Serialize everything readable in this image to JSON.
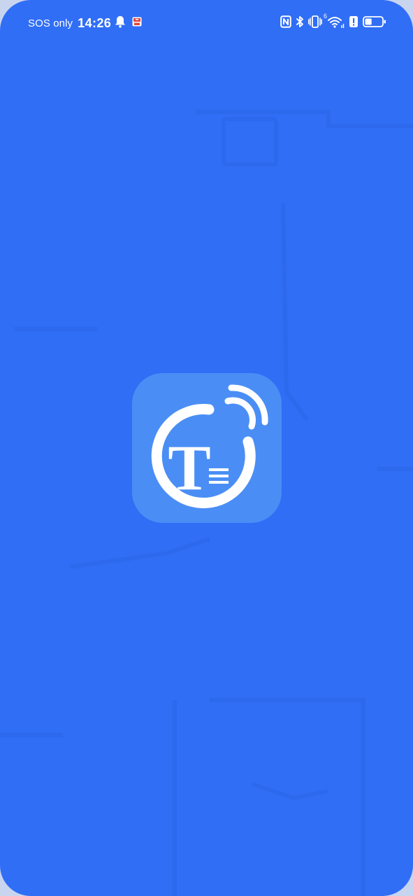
{
  "status_bar": {
    "carrier": "SOS only",
    "time": "14:26",
    "wifi_generation": "6",
    "battery_fraction": 0.4,
    "icons": [
      "bell-icon",
      "app-notification-icon",
      "nfc-icon",
      "bluetooth-icon",
      "vibrate-icon",
      "wifi-icon",
      "alert-icon",
      "battery-icon"
    ]
  },
  "splash": {
    "logo_letter": "T",
    "logo_icon": "tts-broadcast-logo-icon"
  },
  "colors": {
    "background": "#306ef6",
    "logo_tile": "#4a8ef5",
    "logo_foreground": "#ffffff"
  }
}
